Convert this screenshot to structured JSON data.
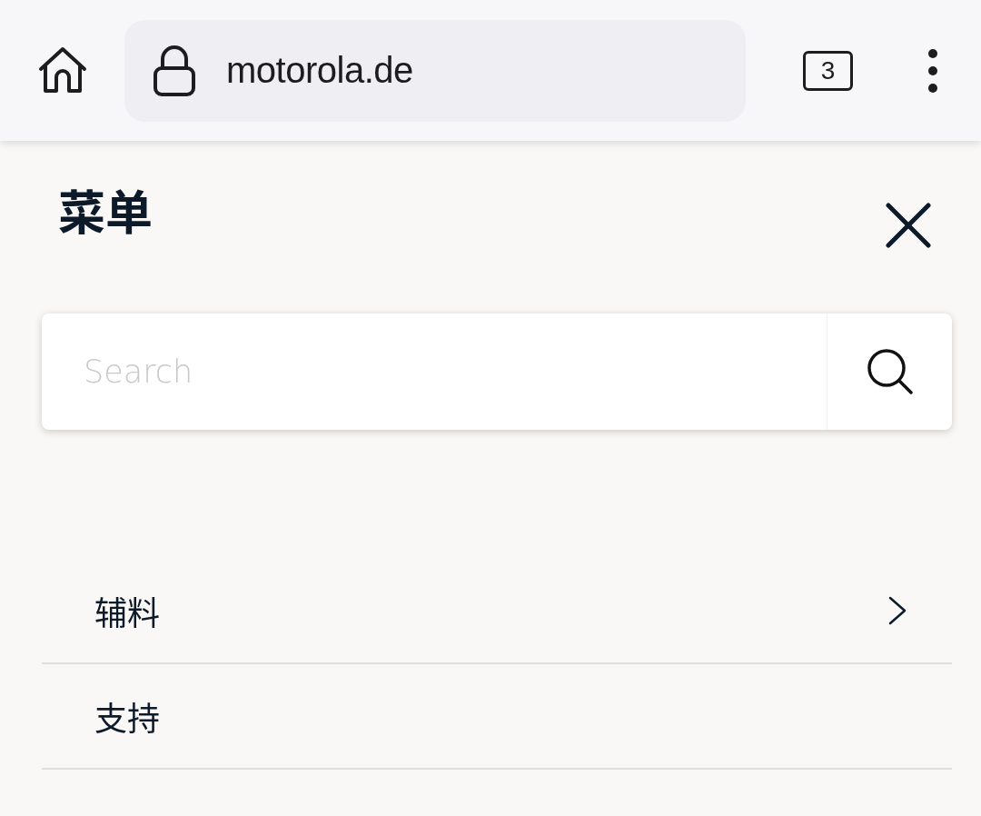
{
  "browser_bar": {
    "url": "motorola.de",
    "tab_count": "3"
  },
  "menu": {
    "title": "菜单",
    "search": {
      "placeholder": "Search"
    },
    "items": [
      {
        "label": "辅料",
        "chevron": true
      },
      {
        "label": "支持",
        "chevron": false
      }
    ]
  }
}
